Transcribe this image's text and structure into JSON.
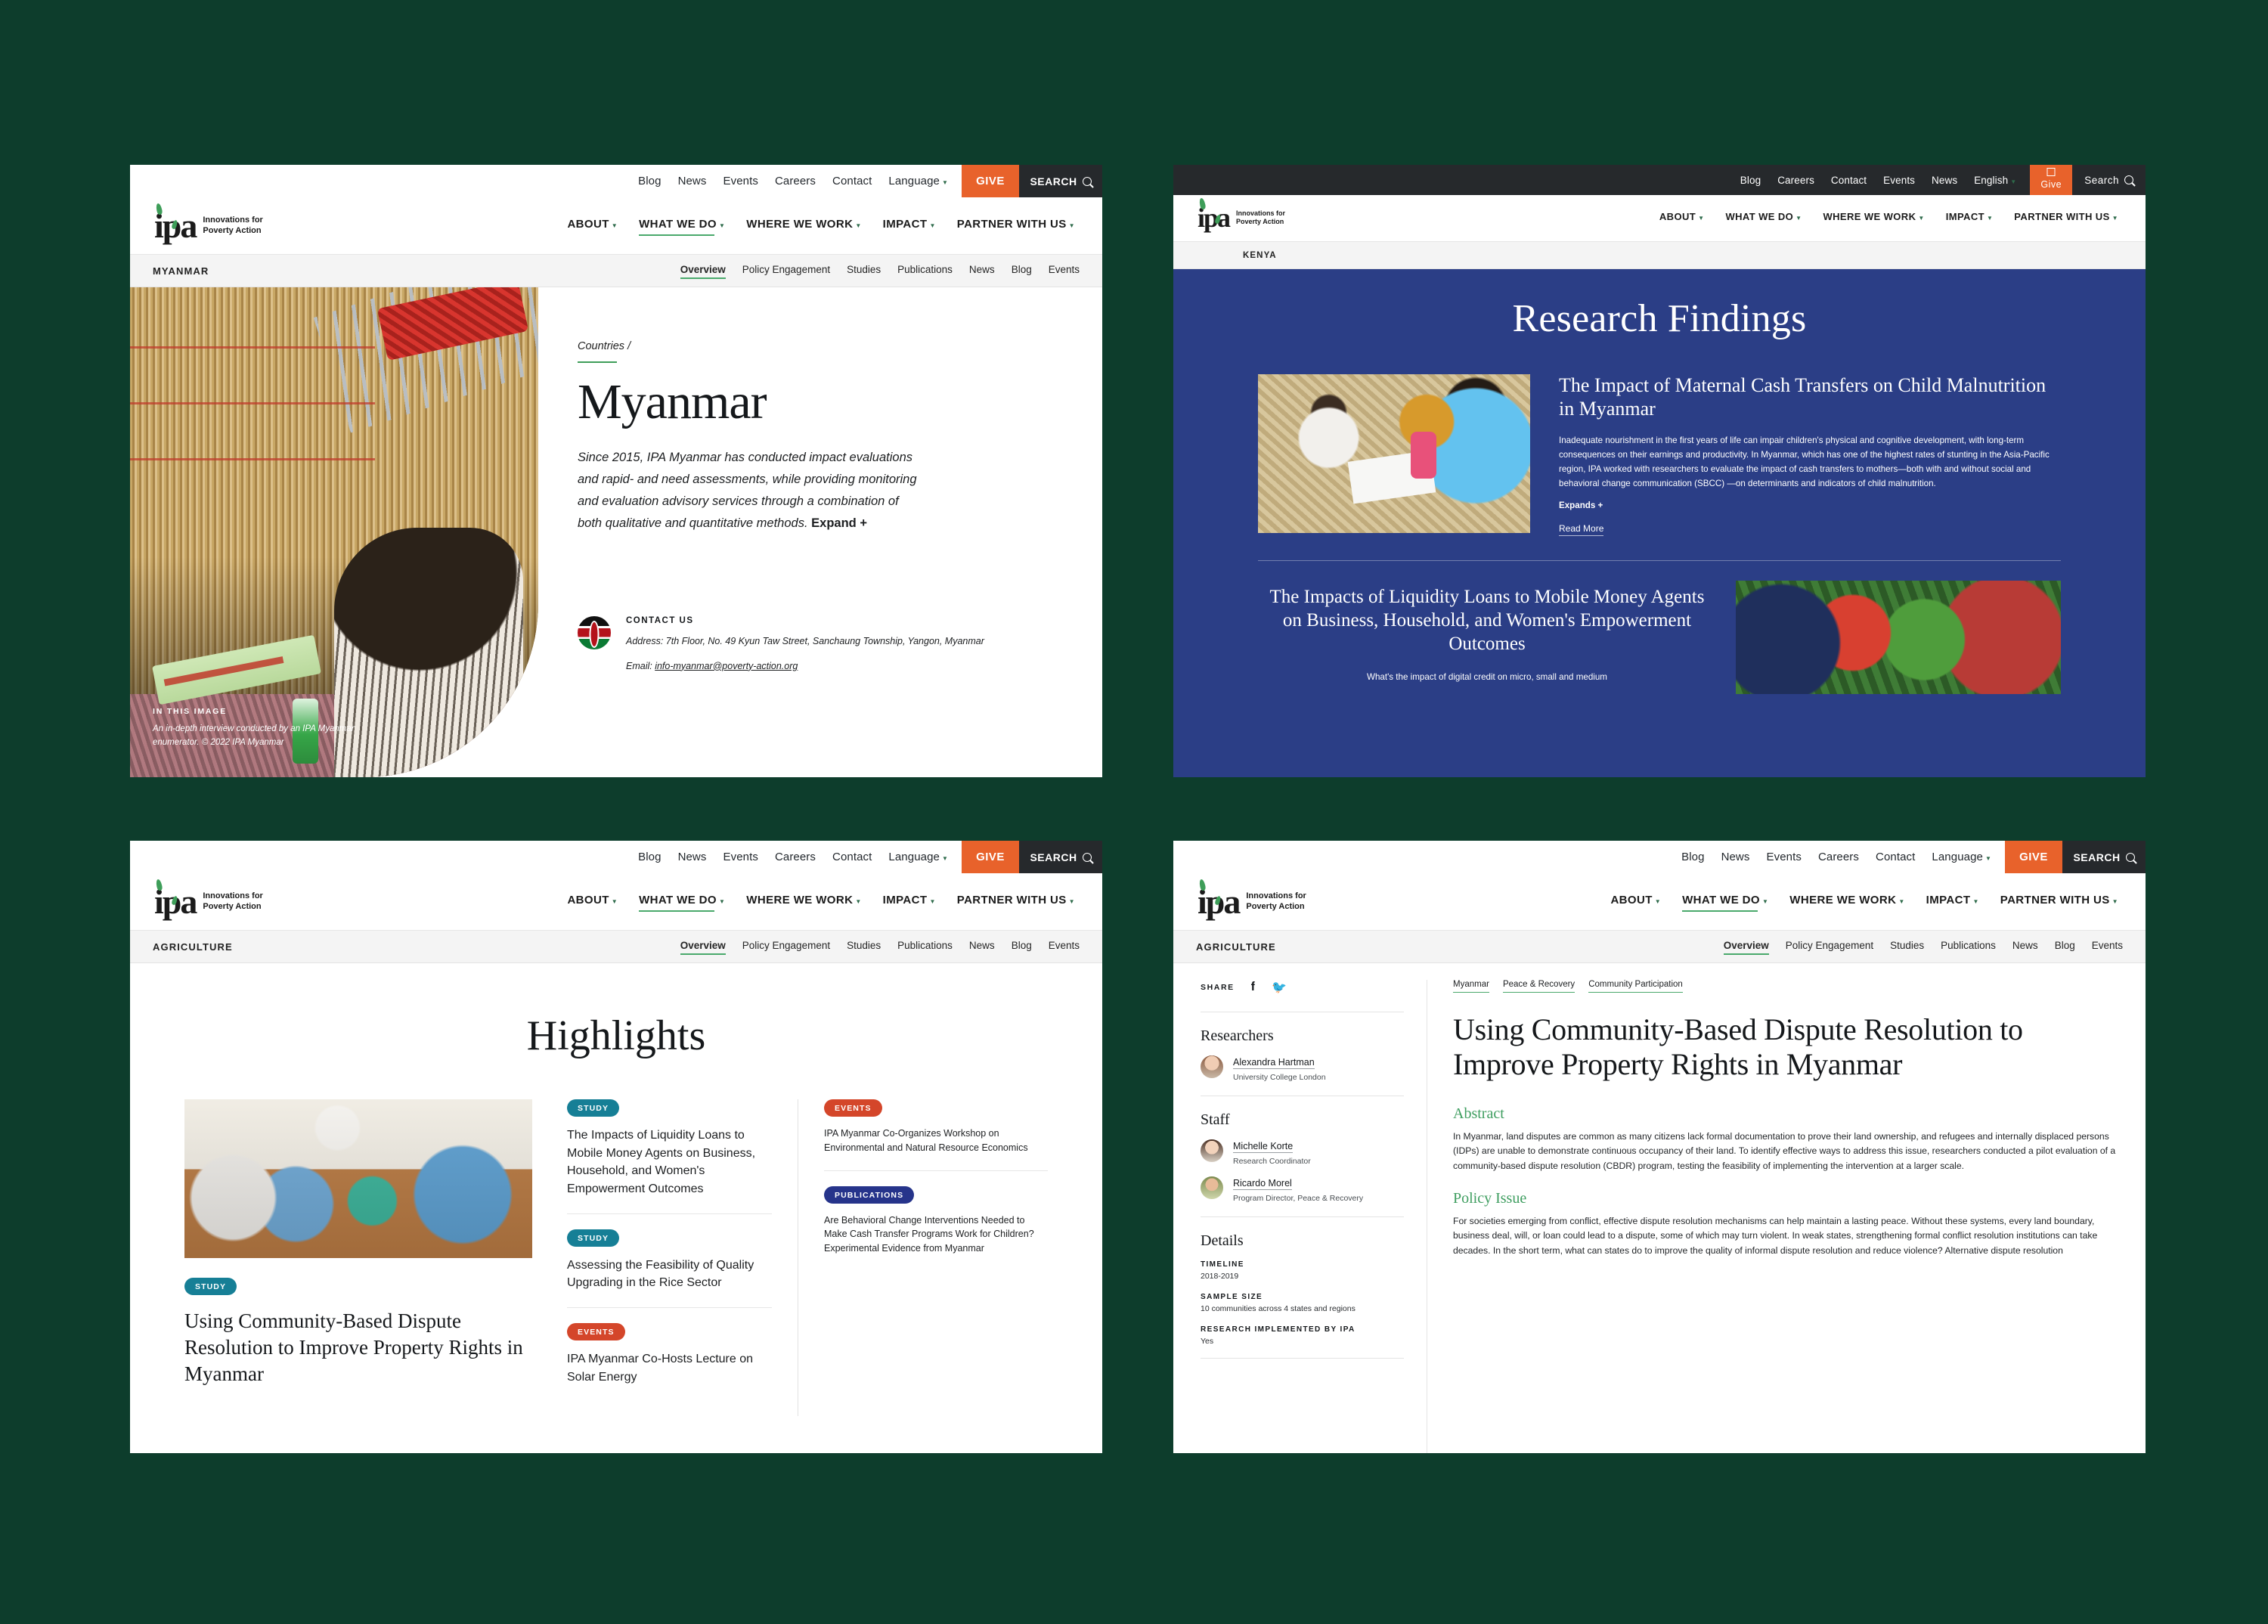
{
  "shared": {
    "brand": {
      "logo_line1": "Innovations for",
      "logo_line2": "Poverty Action",
      "accent_green": "#4aa96c",
      "orange": "#e8622b",
      "dark": "#26292c",
      "board_bg": "#0d3d2c"
    },
    "utility_links": [
      "Blog",
      "News",
      "Events",
      "Careers",
      "Contact",
      "Language"
    ],
    "give_label": "GIVE",
    "search_label": "SEARCH",
    "nav_items": [
      "ABOUT",
      "WHAT WE DO",
      "WHERE WE WORK",
      "IMPACT",
      "PARTNER WITH US"
    ],
    "subnav_tabs": [
      "Overview",
      "Policy Engagement",
      "Studies",
      "Publications",
      "News",
      "Blog",
      "Events"
    ]
  },
  "panel_myanmar": {
    "section_label": "MYANMAR",
    "eyebrow": "Countries /",
    "title": "Myanmar",
    "lede": "Since 2015, IPA Myanmar has conducted impact evaluations and rapid- and need assessments, while providing monitoring and evaluation advisory services through a combination of both qualitative and quantitative methods.",
    "lede_expand": "Expand +",
    "image_caption_label": "IN THIS IMAGE",
    "image_caption": "An in-depth interview conducted by an IPA Myanmar enumerator. © 2022 IPA Myanmar",
    "contact_label": "CONTACT US",
    "contact_address": "Address: 7th Floor, No. 49 Kyun Taw Street, Sanchaung Township, Yangon, Myanmar",
    "contact_email_prefix": "Email: ",
    "contact_email": "info-myanmar@poverty-action.org",
    "flag_icon": "kenya-flag-icon"
  },
  "panel_kenya": {
    "utility_links": [
      "Blog",
      "Careers",
      "Contact",
      "Events",
      "News",
      "English"
    ],
    "give_label": "Give",
    "search_label": "Search",
    "section_label": "KENYA",
    "heading": "Research Findings",
    "background_color": "#2b3e86",
    "findings": [
      {
        "title": "The Impact of Maternal Cash Transfers on Child Malnutrition in Myanmar",
        "body": "Inadequate nourishment in the first years of life can impair children's physical and cognitive development, with long-term consequences on their earnings and productivity. In Myanmar, which has one of the highest rates of stunting in the Asia-Pacific region, IPA worked with researchers to evaluate the impact of cash transfers to mothers—both with and without social and behavioral change communication (SBCC) —on determinants and indicators of child malnutrition.",
        "expand": "Expands +",
        "read_more": "Read More"
      },
      {
        "title": "The Impacts of Liquidity Loans to Mobile Money Agents on Business, Household, and Women's Empowerment Outcomes",
        "body": "What's the impact of digital credit on micro, small and medium"
      }
    ]
  },
  "panel_highlights": {
    "section_label": "AGRICULTURE",
    "heading": "Highlights",
    "feature": {
      "badge": "STUDY",
      "badge_type": "study",
      "headline": "Using Community-Based Dispute Resolution to Improve Property Rights in Myanmar"
    },
    "column_b": [
      {
        "badge": "STUDY",
        "badge_type": "study",
        "text": "The Impacts of Liquidity Loans to Mobile Money Agents on Business, Household, and Women's Empowerment Outcomes"
      },
      {
        "badge": "STUDY",
        "badge_type": "study",
        "text": "Assessing the Feasibility of Quality Upgrading in the Rice Sector"
      },
      {
        "badge": "EVENTS",
        "badge_type": "events",
        "text": "IPA Myanmar Co-Hosts Lecture on Solar Energy"
      }
    ],
    "column_c": [
      {
        "badge": "EVENTS",
        "badge_type": "events",
        "text": "IPA Myanmar Co-Organizes Workshop on Environmental and Natural Resource Economics"
      },
      {
        "badge": "PUBLICATIONS",
        "badge_type": "publications",
        "text": "Are Behavioral Change Interventions Needed to Make Cash Transfer Programs Work for Children? Experimental Evidence from Myanmar"
      }
    ]
  },
  "panel_study": {
    "section_label": "AGRICULTURE",
    "share_label": "SHARE",
    "share_icons": [
      "facebook-icon",
      "twitter-icon"
    ],
    "researchers_heading": "Researchers",
    "researchers": [
      {
        "name": "Alexandra Hartman",
        "role": "University College London"
      }
    ],
    "staff_heading": "Staff",
    "staff": [
      {
        "name": "Michelle Korte",
        "role": "Research Coordinator"
      },
      {
        "name": "Ricardo Morel",
        "role": "Program Director, Peace & Recovery"
      }
    ],
    "details_heading": "Details",
    "details": [
      {
        "key": "TIMELINE",
        "value": "2018-2019"
      },
      {
        "key": "SAMPLE SIZE",
        "value": "10 communities across 4 states and regions"
      },
      {
        "key": "RESEARCH IMPLEMENTED BY IPA",
        "value": "Yes"
      }
    ],
    "breadcrumbs": [
      "Myanmar",
      "Peace & Recovery",
      "Community Participation"
    ],
    "title": "Using Community-Based Dispute Resolution to Improve Property Rights in Myanmar",
    "sections": [
      {
        "heading": "Abstract",
        "body": "In Myanmar, land disputes are common as many citizens lack formal documentation to prove their land ownership, and refugees and internally displaced persons (IDPs) are unable to demonstrate continuous occupancy of their land. To identify effective ways to address this issue, researchers conducted a pilot evaluation of a community-based dispute resolution (CBDR) program, testing the feasibility of implementing the intervention at a larger scale."
      },
      {
        "heading": "Policy Issue",
        "body": "For societies emerging from conflict, effective dispute resolution mechanisms can help maintain a lasting peace. Without these systems, every land boundary, business deal, will, or loan could lead to a dispute, some of which may turn violent. In weak states, strengthening formal conflict resolution institutions can take decades. In the short term, what can states do to improve the quality of informal dispute resolution and reduce violence? Alternative dispute resolution"
      }
    ]
  }
}
